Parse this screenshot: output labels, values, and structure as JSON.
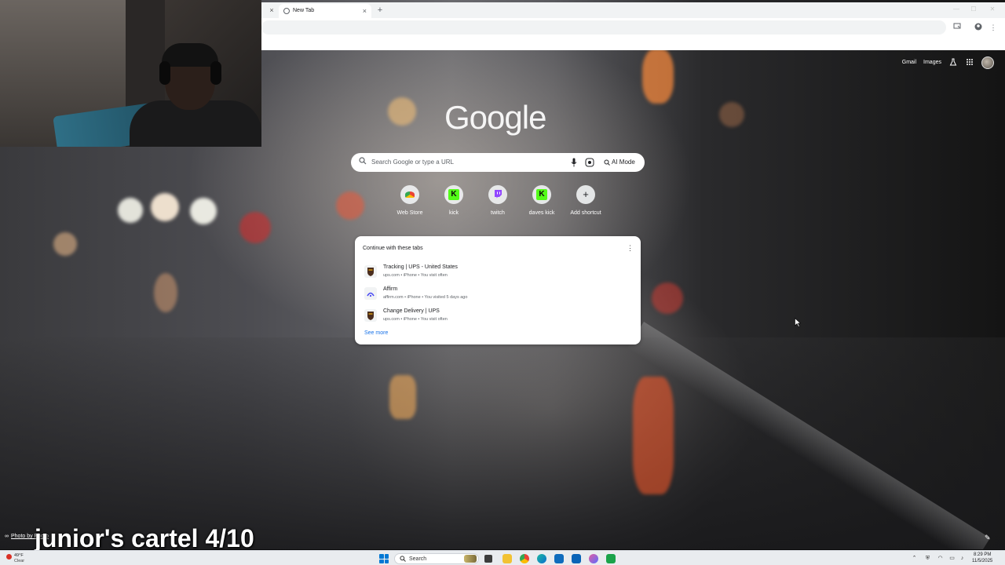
{
  "browser": {
    "tab_title": "New Tab",
    "tab_close": "×",
    "prev_tab_close": "×",
    "new_tab": "+"
  },
  "ntp": {
    "top_links": {
      "gmail": "Gmail",
      "images": "Images"
    },
    "logo_text": "Google",
    "search": {
      "placeholder": "Search Google or type a URL",
      "ai_mode": "AI Mode"
    },
    "shortcuts": [
      {
        "label": "Web Store",
        "icon": "web-store-icon",
        "color": "#e8eaed"
      },
      {
        "label": "kick",
        "icon": "kick-icon",
        "color": "#53fc18"
      },
      {
        "label": "twitch",
        "icon": "twitch-icon",
        "color": "#9146ff"
      },
      {
        "label": "daves kick",
        "icon": "kick-icon",
        "color": "#53fc18"
      },
      {
        "label": "Add shortcut",
        "icon": "plus-icon",
        "color": "#e8eaed"
      }
    ],
    "card": {
      "title": "Continue with these tabs",
      "rows": [
        {
          "title": "Tracking | UPS - United States",
          "meta": "ups.com • iPhone • You visit often",
          "icon": "ups-icon"
        },
        {
          "title": "Affirm",
          "meta": "affirm.com • iPhone • You visited 5 days ago",
          "icon": "affirm-icon"
        },
        {
          "title": "Change Delivery | UPS",
          "meta": "ups.com • iPhone • You visit often",
          "icon": "ups-icon"
        }
      ],
      "see_more": "See more"
    },
    "photo_credit": "Photo by Photo"
  },
  "overlay": {
    "caption": "junior's cartel 4/10"
  },
  "taskbar": {
    "weather_temp": "49°F",
    "weather_condition": "Clear",
    "search_label": "Search",
    "time": "8:29 PM",
    "date": "11/5/2025"
  },
  "colors": {
    "ups_brown": "#4b2e1e",
    "ups_gold": "#f6b40e",
    "accent_blue": "#1a73e8"
  }
}
